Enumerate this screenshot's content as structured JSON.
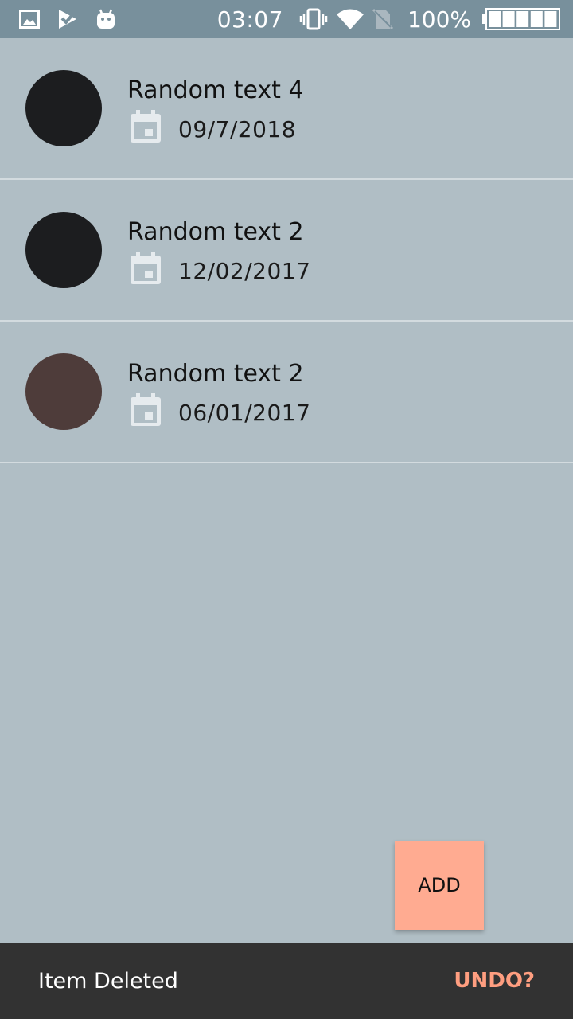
{
  "status_bar": {
    "time": "03:07",
    "battery_percent": "100%",
    "battery_level": 1.0,
    "icons": [
      "image-icon",
      "check-flag-icon",
      "android-icon",
      "vibrate-icon",
      "wifi-icon",
      "no-sim-icon",
      "battery-icon"
    ]
  },
  "list": {
    "items": [
      {
        "title": "Random text 4",
        "date": "09/7/2018",
        "avatar_color": "#1c1d1f"
      },
      {
        "title": "Random text 2",
        "date": "12/02/2017",
        "avatar_color": "#1c1d1f"
      },
      {
        "title": "Random text 2",
        "date": "06/01/2017",
        "avatar_color": "#4e3c3a"
      }
    ]
  },
  "fab": {
    "label": "ADD",
    "color": "#ffab91"
  },
  "snackbar": {
    "message": "Item Deleted",
    "action": "UNDO?",
    "action_color": "#ff9e80"
  },
  "colors": {
    "background": "#b0bec5",
    "status_bar": "#78909c",
    "icon_tint": "#e6ebee"
  }
}
